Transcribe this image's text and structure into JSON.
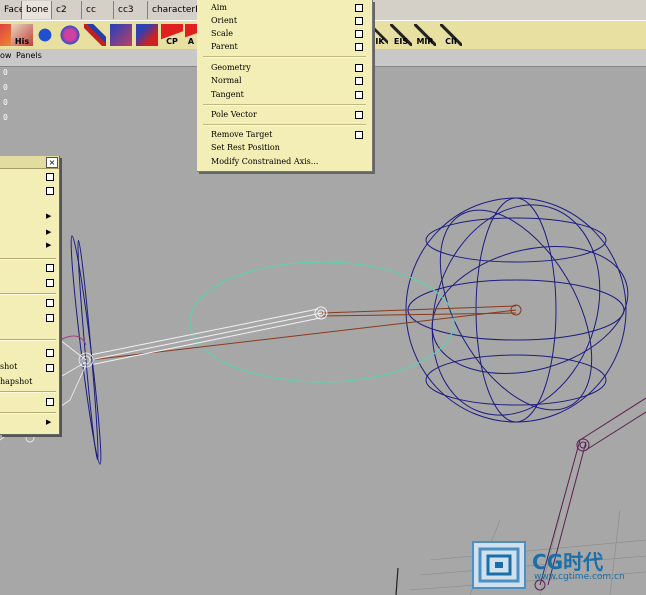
{
  "shelf_tabs": [
    "Faces",
    "bone",
    "c2",
    "cc",
    "cc3",
    "characterPos"
  ],
  "shelf_icons_left": [
    {
      "name": "joint-tool-icon",
      "label": ""
    },
    {
      "name": "history-icon",
      "label": "His"
    },
    {
      "name": "skin-bind-icon",
      "label": ""
    },
    {
      "name": "paint-weights-icon",
      "label": ""
    },
    {
      "name": "ik-handle-icon",
      "label": ""
    },
    {
      "name": "component-editor-icon",
      "label": ""
    },
    {
      "name": "paint-icon",
      "label": ""
    },
    {
      "name": "constraint-point-icon",
      "label": "CP"
    },
    {
      "name": "constraint-aim-icon",
      "label": "A"
    }
  ],
  "shelf_icons_right": [
    {
      "name": "ik-key-icon",
      "label": "IK"
    },
    {
      "name": "eis-key-icon",
      "label": "EIS"
    },
    {
      "name": "mirror-key-icon",
      "label": "MIR"
    },
    {
      "name": "cii-key-icon",
      "label": "CII"
    }
  ],
  "panel_menu": {
    "show": "ow",
    "panels": "Panels"
  },
  "hud_values": [
    "0",
    "0",
    "0",
    "0"
  ],
  "constrain_menu": {
    "group1": [
      "Aim",
      "Orient",
      "Scale",
      "Parent"
    ],
    "group2": [
      "Geometry",
      "Normal",
      "Tangent"
    ],
    "group3": [
      "Pole Vector"
    ],
    "group4": [
      "Remove Target",
      "Set Rest Position",
      "Modify Constrained Axis..."
    ]
  },
  "left_menu": {
    "close": "×",
    "snapshot_items": [
      "shot",
      "hapshot"
    ]
  },
  "watermark": {
    "brand": "CG时代",
    "url": "www.cgtime.com.cn"
  },
  "colors": {
    "menu_bg": "#f3eeb6",
    "shelf_bg": "#e8e0a0",
    "viewport_bg": "#a7a7a7",
    "sphere_wire": "#1a1a7a",
    "circle_wire": "#5fcfb0",
    "bone_brown": "#8a3a1a",
    "bone_purple": "#5a2050"
  }
}
